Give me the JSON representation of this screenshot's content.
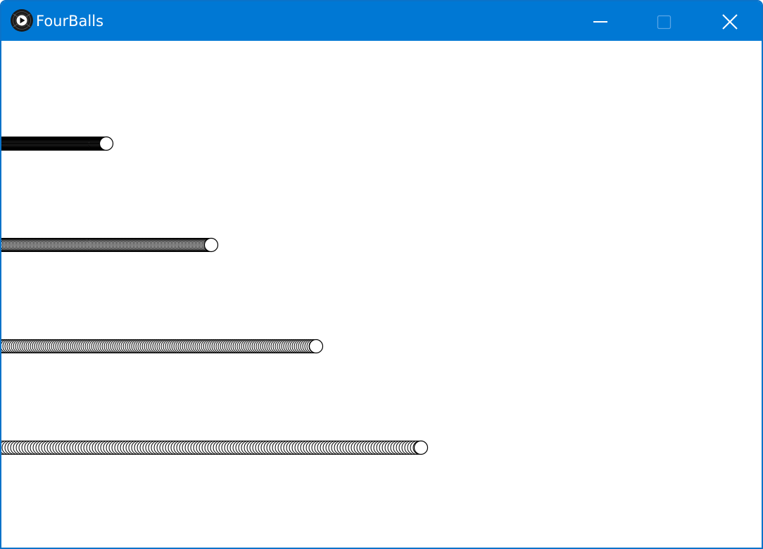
{
  "window": {
    "title": "FourBalls",
    "app_icon": "play-disc-icon",
    "controls": {
      "minimize_icon": "minimize-icon",
      "maximize_icon": "maximize-icon",
      "close_icon": "close-icon"
    }
  },
  "colors": {
    "titlebar": "#0078d4",
    "title_text": "#ffffff",
    "canvas_bg": "#ffffff",
    "ball_fill": "#ffffff",
    "ball_stroke": "#000000"
  },
  "balls": [
    {
      "id": "ball-1",
      "trail_density": "dense"
    },
    {
      "id": "ball-2",
      "trail_density": "medium"
    },
    {
      "id": "ball-3",
      "trail_density": "sparse"
    },
    {
      "id": "ball-4",
      "trail_density": "sparser"
    }
  ]
}
